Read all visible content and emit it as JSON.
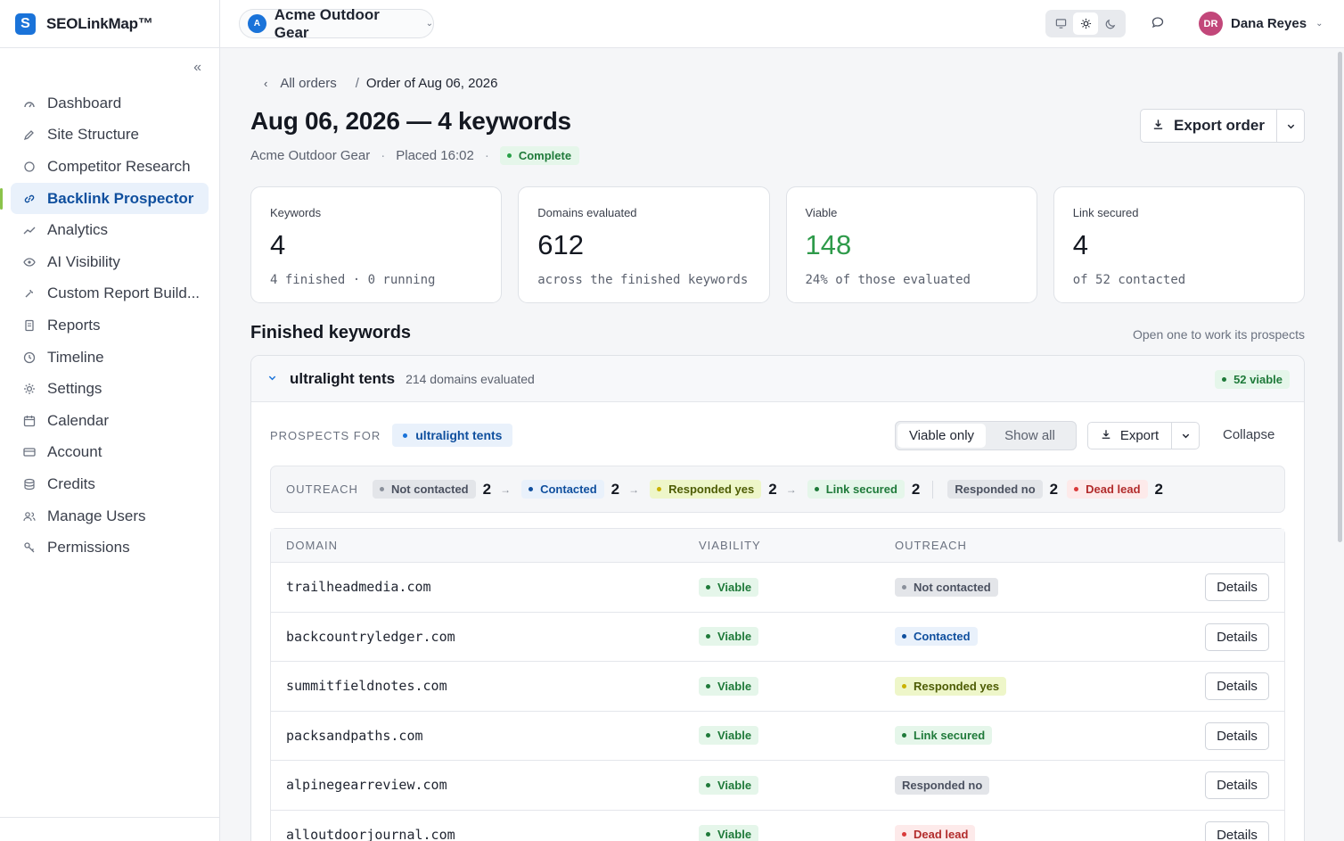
{
  "brand": {
    "name": "SEOLinkMap™",
    "logo_letter": "S"
  },
  "sidebar": {
    "collapse_icon": "double-chevron-left-icon",
    "items": [
      {
        "label": "Dashboard",
        "icon": "gauge-icon"
      },
      {
        "label": "Site Structure",
        "icon": "pencil-icon"
      },
      {
        "label": "Competitor Research",
        "icon": "target-icon"
      },
      {
        "label": "Backlink Prospector",
        "icon": "link-icon",
        "active": true
      },
      {
        "label": "Analytics",
        "icon": "trend-icon"
      },
      {
        "label": "AI Visibility",
        "icon": "eye-icon"
      },
      {
        "label": "Custom Report Build...",
        "icon": "wrench-icon"
      },
      {
        "label": "Reports",
        "icon": "document-icon"
      },
      {
        "label": "Timeline",
        "icon": "clock-icon"
      },
      {
        "label": "Settings",
        "icon": "gear-icon"
      },
      {
        "label": "Calendar",
        "icon": "calendar-icon"
      },
      {
        "label": "Account",
        "icon": "card-icon"
      },
      {
        "label": "Credits",
        "icon": "database-icon"
      },
      {
        "label": "Manage Users",
        "icon": "users-icon"
      },
      {
        "label": "Permissions",
        "icon": "key-icon"
      }
    ]
  },
  "topbar": {
    "project": {
      "badge": "A",
      "name": "Acme Outdoor Gear"
    },
    "user": {
      "initials": "DR",
      "name": "Dana Reyes"
    }
  },
  "breadcrumb": {
    "back": "All orders",
    "separator": "/",
    "current": "Order of Aug 06, 2026"
  },
  "page": {
    "title": "Aug 06, 2026 — 4 keywords",
    "project": "Acme Outdoor Gear",
    "placed": "Placed 16:02",
    "dot": "·",
    "status": "Complete",
    "export_label": "Export order"
  },
  "stats": [
    {
      "label": "Keywords",
      "value": "4",
      "note": "4 finished · 0 running"
    },
    {
      "label": "Domains evaluated",
      "value": "612",
      "note": "across the finished keywords"
    },
    {
      "label": "Viable",
      "value": "148",
      "note": "24% of those evaluated"
    },
    {
      "label": "Link secured",
      "value": "4",
      "note": "of 52 contacted"
    }
  ],
  "finished": {
    "title": "Finished keywords",
    "hint": "Open one to work its prospects"
  },
  "keyword_panel": {
    "keyword": "ultralight tents",
    "domains_count": "214 domains evaluated",
    "viable_badge": "52 viable",
    "prospects_label": "PROSPECTS FOR",
    "seg_viable": "Viable only",
    "seg_all": "Show all",
    "export_label": "Export",
    "collapse_label": "Collapse",
    "outreach_label": "OUTREACH",
    "stages": [
      {
        "label": "Not contacted",
        "count": "2"
      },
      {
        "label": "Contacted",
        "count": "2"
      },
      {
        "label": "Responded yes",
        "count": "2"
      },
      {
        "label": "Link secured",
        "count": "2"
      },
      {
        "label": "Responded no",
        "count": "2"
      },
      {
        "label": "Dead lead",
        "count": "2"
      }
    ],
    "table": {
      "headers": {
        "domain": "DOMAIN",
        "viability": "VIABILITY",
        "outreach": "OUTREACH"
      },
      "details_label": "Details",
      "rows": [
        {
          "domain": "trailheadmedia.com",
          "viability": "Viable",
          "outreach": "Not contacted"
        },
        {
          "domain": "backcountryledger.com",
          "viability": "Viable",
          "outreach": "Contacted"
        },
        {
          "domain": "summitfieldnotes.com",
          "viability": "Viable",
          "outreach": "Responded yes"
        },
        {
          "domain": "packsandpaths.com",
          "viability": "Viable",
          "outreach": "Link secured"
        },
        {
          "domain": "alpinegearreview.com",
          "viability": "Viable",
          "outreach": "Responded no"
        },
        {
          "domain": "alloutdoorjournal.com",
          "viability": "Viable",
          "outreach": "Dead lead"
        }
      ]
    }
  }
}
